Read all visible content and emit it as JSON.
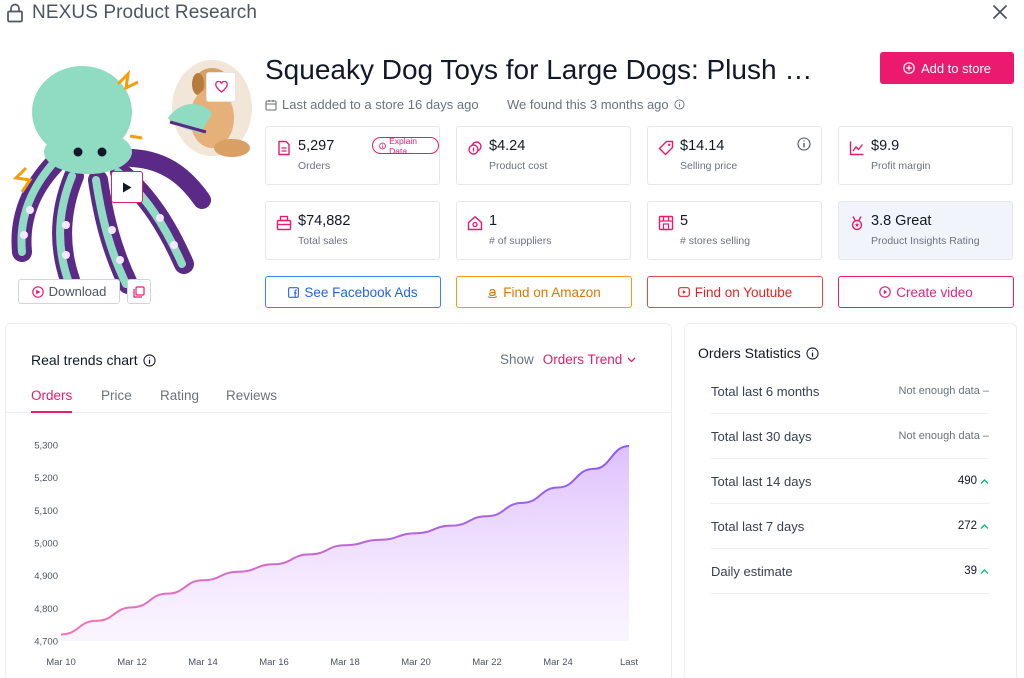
{
  "app": {
    "title": "NEXUS Product Research"
  },
  "product": {
    "title": "Squeaky Dog Toys for Large Dogs: Plush …",
    "last_added": "Last added to a store 16 days ago",
    "found": "We found this 3 months ago"
  },
  "buttons": {
    "add_to_store": "Add to store",
    "download": "Download",
    "facebook": "See Facebook Ads",
    "amazon": "Find on Amazon",
    "youtube": "Find on Youtube",
    "video": "Create video",
    "explain": "Explain Data"
  },
  "stats": [
    {
      "value": "5,297",
      "label": "Orders",
      "icon": "document-icon"
    },
    {
      "value": "$4.24",
      "label": "Product cost",
      "icon": "coins-icon"
    },
    {
      "value": "$14.14",
      "label": "Selling price",
      "icon": "tag-icon"
    },
    {
      "value": "$9.9",
      "label": "Profit margin",
      "icon": "trend-chart-icon"
    },
    {
      "value": "$74,882",
      "label": "Total sales",
      "icon": "register-icon"
    },
    {
      "value": "1",
      "label": "# of suppliers",
      "icon": "home-icon"
    },
    {
      "value": "5",
      "label": "# stores selling",
      "icon": "store-icon"
    },
    {
      "value": "3.8 Great",
      "label": "Product Insights Rating",
      "icon": "award-icon"
    }
  ],
  "trends": {
    "title": "Real trends chart",
    "show_label": "Show",
    "show_value": "Orders Trend",
    "tabs": [
      "Orders",
      "Price",
      "Rating",
      "Reviews"
    ],
    "active_tab": "Orders"
  },
  "orders_stats": {
    "title": "Orders Statistics",
    "rows": [
      {
        "label": "Total last 6 months",
        "value": "Not enough data",
        "trend": "none"
      },
      {
        "label": "Total last 30 days",
        "value": "Not enough data",
        "trend": "none"
      },
      {
        "label": "Total last 14 days",
        "value": "490",
        "trend": "up"
      },
      {
        "label": "Total last 7 days",
        "value": "272",
        "trend": "up"
      },
      {
        "label": "Daily estimate",
        "value": "39",
        "trend": "up"
      }
    ]
  },
  "colors": {
    "accent": "#ec1a6e",
    "line": "#a855f7"
  },
  "chart_data": {
    "type": "area",
    "x": [
      "Mar 10",
      "Mar 11",
      "Mar 12",
      "Mar 13",
      "Mar 14",
      "Mar 15",
      "Mar 16",
      "Mar 17",
      "Mar 18",
      "Mar 19",
      "Mar 20",
      "Mar 21",
      "Mar 22",
      "Mar 23",
      "Mar 24",
      "Mar 25",
      "Last"
    ],
    "x_tick_labels": [
      "Mar 10",
      "Mar 12",
      "Mar 14",
      "Mar 16",
      "Mar 18",
      "Mar 20",
      "Mar 22",
      "Mar 24",
      "Last"
    ],
    "series": [
      {
        "values": [
          4720,
          4762,
          4803,
          4845,
          4886,
          4912,
          4935,
          4965,
          4993,
          5010,
          5030,
          5053,
          5082,
          5123,
          5170,
          5227,
          5297
        ]
      }
    ],
    "yticks": [
      4700,
      4800,
      4900,
      5000,
      5100,
      5200,
      5300
    ],
    "ytick_labels": [
      "4,700",
      "4,800",
      "4,900",
      "5,000",
      "5,100",
      "5,200",
      "5,300"
    ],
    "ylim": [
      4700,
      5300
    ],
    "grid": false,
    "title": "",
    "xlabel": "",
    "ylabel": ""
  }
}
